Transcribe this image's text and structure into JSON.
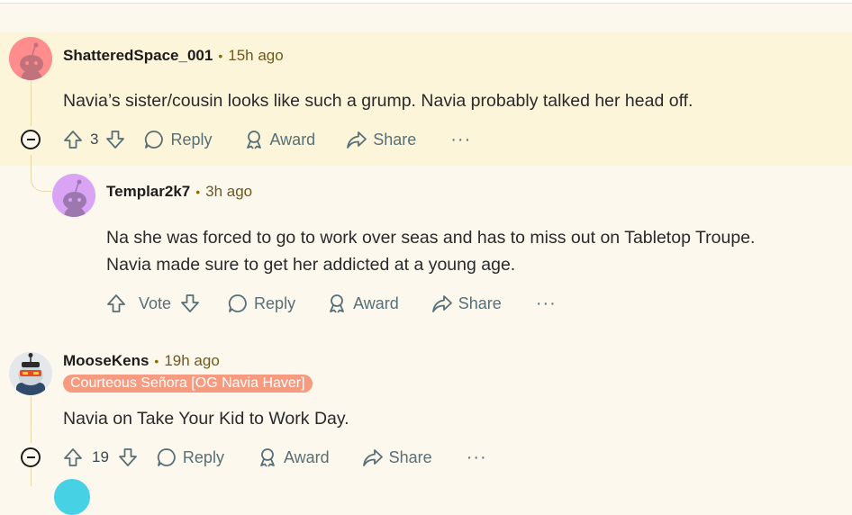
{
  "comments": [
    {
      "username": "ShatteredSpace_001",
      "separator": "•",
      "time": "15h ago",
      "text": "Navia’s sister/cousin looks like such a grump. Navia probably talked her head off.",
      "votes": "3",
      "reply_label": "Reply",
      "award_label": "Award",
      "share_label": "Share",
      "more_label": "···",
      "avatar_color": "#ff8d8d"
    },
    {
      "username": "Templar2k7",
      "separator": "•",
      "time": "3h ago",
      "text_line1": "Na she was forced to go to work over seas and has to miss out on Tabletop Troupe.",
      "text_line2": "Navia made sure to get her addicted at a young age.",
      "votes": "Vote",
      "reply_label": "Reply",
      "award_label": "Award",
      "share_label": "Share",
      "more_label": "···",
      "avatar_color": "#d9a4f5"
    },
    {
      "username": "MooseKens",
      "separator": "•",
      "time": "19h ago",
      "flair": "Courteous Señora [OG Navia Haver]",
      "text": "Navia on Take Your Kid to Work Day.",
      "votes": "19",
      "reply_label": "Reply",
      "award_label": "Award",
      "share_label": "Share",
      "more_label": "···"
    }
  ],
  "colors": {
    "highlight": "#fdf5d9",
    "background": "#fdf8ee",
    "flair": "#f69a80",
    "action": "#576f76"
  }
}
